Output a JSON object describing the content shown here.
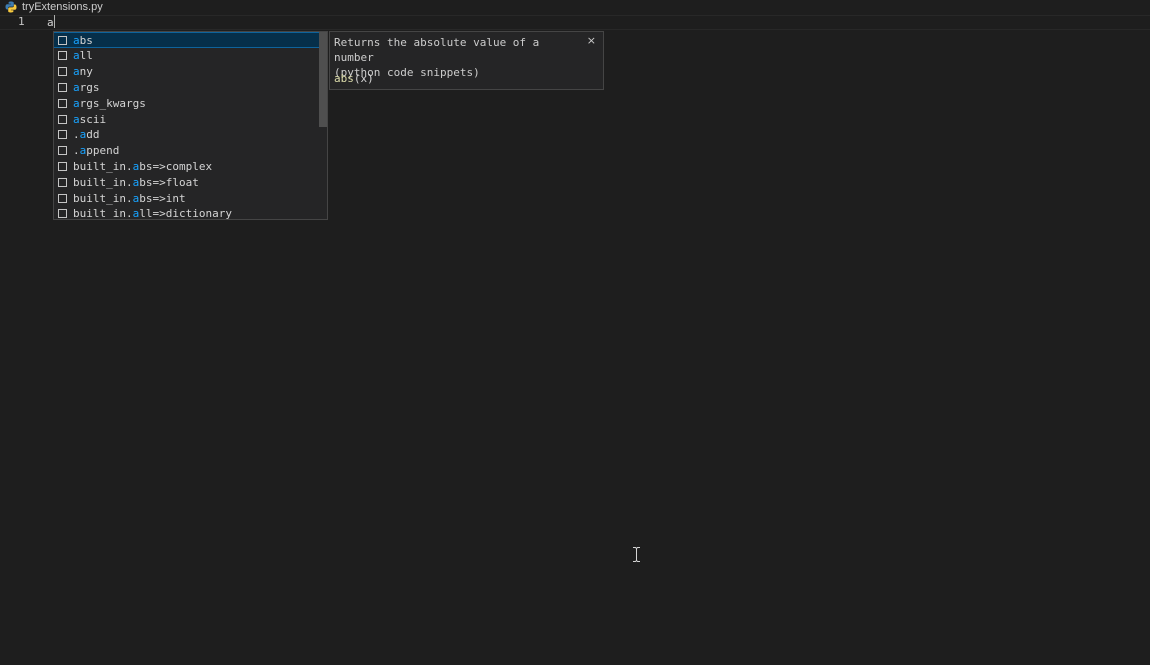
{
  "tab": {
    "filename": "tryExtensions.py",
    "icon": "python-file-icon"
  },
  "editor": {
    "line_number": "1",
    "line_text": "a"
  },
  "suggestions": [
    {
      "prefix": "",
      "match": "a",
      "rest": "bs",
      "selected": true
    },
    {
      "prefix": "",
      "match": "a",
      "rest": "ll"
    },
    {
      "prefix": "",
      "match": "a",
      "rest": "ny"
    },
    {
      "prefix": "",
      "match": "a",
      "rest": "rgs"
    },
    {
      "prefix": "",
      "match": "a",
      "rest": "rgs_kwargs"
    },
    {
      "prefix": "",
      "match": "a",
      "rest": "scii"
    },
    {
      "prefix": ".",
      "match": "a",
      "rest": "dd"
    },
    {
      "prefix": ".",
      "match": "a",
      "rest": "ppend"
    },
    {
      "prefix": "built_in.",
      "match": "a",
      "rest": "bs=>complex"
    },
    {
      "prefix": "built_in.",
      "match": "a",
      "rest": "bs=>float"
    },
    {
      "prefix": "built_in.",
      "match": "a",
      "rest": "bs=>int"
    },
    {
      "prefix": "built_in.",
      "match": "a",
      "rest": "ll=>dictionary"
    }
  ],
  "details": {
    "doc_line1": "Returns the absolute value of a number",
    "doc_line2": "(python code snippets)",
    "signature_name": "abs",
    "signature_args": "(x)",
    "close_label": "×"
  },
  "colors": {
    "background": "#1e1e1e",
    "match_highlight": "#18a3ff",
    "selected_row": "#062f4a"
  }
}
